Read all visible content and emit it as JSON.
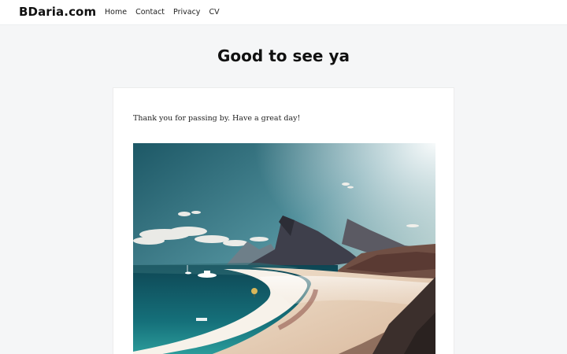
{
  "site": {
    "brand": "BDaria.com"
  },
  "nav": {
    "items": [
      {
        "label": "Home"
      },
      {
        "label": "Contact"
      },
      {
        "label": "Privacy"
      },
      {
        "label": "CV"
      }
    ]
  },
  "page": {
    "title": "Good to see ya"
  },
  "content": {
    "intro": "Thank you for passing by. Have a great day!"
  }
}
